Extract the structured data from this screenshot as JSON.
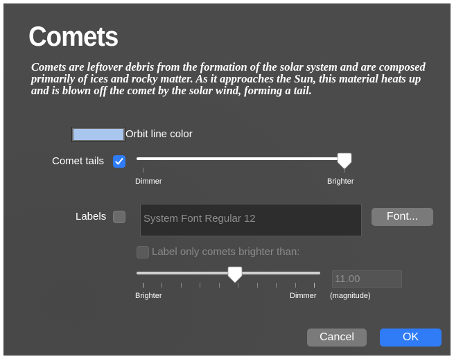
{
  "dialog": {
    "title": "Comets",
    "description": "Comets are leftover debris from the formation of the solar system and are composed primarily of ices and rocky matter. As it approaches the Sun, this material heats up and is blown off the comet by the solar wind, forming a tail."
  },
  "orbit": {
    "label": "Orbit line color",
    "color": "#a9c7ee"
  },
  "tails": {
    "label": "Comet tails",
    "checked": true,
    "slider_value": 0.98,
    "min_label": "Dimmer",
    "max_label": "Brighter"
  },
  "labels": {
    "label": "Labels",
    "checked": false,
    "font_value": "System Font Regular 12",
    "font_button": "Font..."
  },
  "label_filter": {
    "label": "Label only comets brighter than:",
    "checked": false,
    "slider_value": 0.5,
    "min_label": "Brighter",
    "max_label": "Dimmer",
    "magnitude_value": "11.00",
    "magnitude_unit": "(magnitude)"
  },
  "buttons": {
    "cancel": "Cancel",
    "ok": "OK"
  },
  "colors": {
    "accent": "#2f7cf6",
    "background": "#4a4a4a"
  }
}
